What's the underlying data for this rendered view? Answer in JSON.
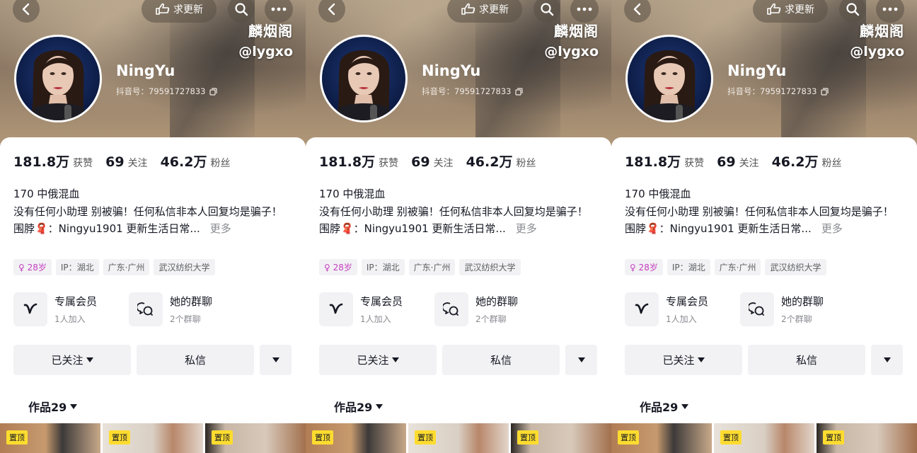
{
  "panels": [
    {
      "nav": {
        "updates_label": "求更新"
      },
      "watermark": {
        "line1": "麟烟阁",
        "line2": "@lygxo"
      },
      "profile": {
        "nickname": "NingYu",
        "douyin_id": "抖音号：79591727833"
      },
      "stats": [
        {
          "value": "181.8万",
          "label": "获赞"
        },
        {
          "value": "69",
          "label": "关注"
        },
        {
          "value": "46.2万",
          "label": "粉丝"
        }
      ],
      "bio": {
        "line1": "170 中俄混血",
        "line2": "没有任何小助理 别被骗！任何私信非本人回复均是骗子！",
        "line3": "围脖🧣：Ningyu1901   更新生活日常...",
        "more": "更多"
      },
      "tags": [
        "♀ 28岁",
        "IP：湖北",
        "广东·广州",
        "武汉纺织大学"
      ],
      "features": [
        {
          "title": "专属会员",
          "subtitle": "1人加入",
          "icon": "vip-v-icon"
        },
        {
          "title": "她的群聊",
          "subtitle": "2个群聊",
          "icon": "group-chat-icon"
        }
      ],
      "actions": {
        "follow_label": "已关注",
        "dm_label": "私信"
      },
      "works_tab": {
        "label": "作品29"
      },
      "grid": [
        {
          "badge": "置顶"
        },
        {
          "badge": "置顶"
        },
        {
          "badge": "置顶"
        }
      ]
    },
    {
      "nav": {
        "updates_label": "求更新"
      },
      "watermark": {
        "line1": "麟烟阁",
        "line2": "@lygxo"
      },
      "profile": {
        "nickname": "NingYu",
        "douyin_id": "抖音号：79591727833"
      },
      "stats": [
        {
          "value": "181.8万",
          "label": "获赞"
        },
        {
          "value": "69",
          "label": "关注"
        },
        {
          "value": "46.2万",
          "label": "粉丝"
        }
      ],
      "bio": {
        "line1": "170 中俄混血",
        "line2": "没有任何小助理 别被骗！任何私信非本人回复均是骗子！",
        "line3": "围脖🧣：Ningyu1901   更新生活日常...",
        "more": "更多"
      },
      "tags": [
        "♀ 28岁",
        "IP：湖北",
        "广东·广州",
        "武汉纺织大学"
      ],
      "features": [
        {
          "title": "专属会员",
          "subtitle": "1人加入",
          "icon": "vip-v-icon"
        },
        {
          "title": "她的群聊",
          "subtitle": "2个群聊",
          "icon": "group-chat-icon"
        }
      ],
      "actions": {
        "follow_label": "已关注",
        "dm_label": "私信"
      },
      "works_tab": {
        "label": "作品29"
      },
      "grid": [
        {
          "badge": "置顶"
        },
        {
          "badge": "置顶"
        },
        {
          "badge": "置顶"
        }
      ]
    },
    {
      "nav": {
        "updates_label": "求更新"
      },
      "watermark": {
        "line1": "麟烟阁",
        "line2": "@lygxo"
      },
      "profile": {
        "nickname": "NingYu",
        "douyin_id": "抖音号：79591727833"
      },
      "stats": [
        {
          "value": "181.8万",
          "label": "获赞"
        },
        {
          "value": "69",
          "label": "关注"
        },
        {
          "value": "46.2万",
          "label": "粉丝"
        }
      ],
      "bio": {
        "line1": "170 中俄混血",
        "line2": "没有任何小助理 别被骗！任何私信非本人回复均是骗子！",
        "line3": "围脖🧣：Ningyu1901   更新生活日常...",
        "more": "更多"
      },
      "tags": [
        "♀ 28岁",
        "IP：湖北",
        "广东·广州",
        "武汉纺织大学"
      ],
      "features": [
        {
          "title": "专属会员",
          "subtitle": "1人加入",
          "icon": "vip-v-icon"
        },
        {
          "title": "她的群聊",
          "subtitle": "2个群聊",
          "icon": "group-chat-icon"
        }
      ],
      "actions": {
        "follow_label": "已关注",
        "dm_label": "私信"
      },
      "works_tab": {
        "label": "作品29"
      },
      "grid": [
        {
          "badge": "置顶"
        },
        {
          "badge": "置顶"
        },
        {
          "badge": "置顶"
        }
      ]
    }
  ]
}
